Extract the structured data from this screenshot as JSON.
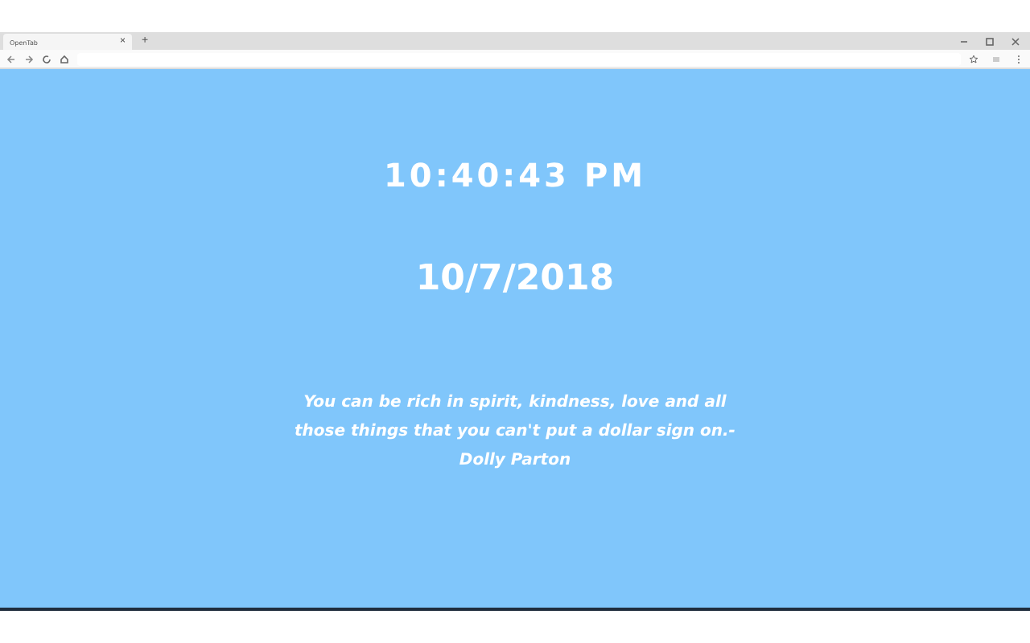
{
  "browser": {
    "tab_title": "OpenTab",
    "tab_close": "×",
    "new_tab": "+"
  },
  "clock": {
    "time": "10:40:43 PM",
    "date": "10/7/2018"
  },
  "quote": {
    "text": "You can be rich in spirit, kindness, love and all those things that you can't put a dollar sign on.- Dolly Parton"
  }
}
